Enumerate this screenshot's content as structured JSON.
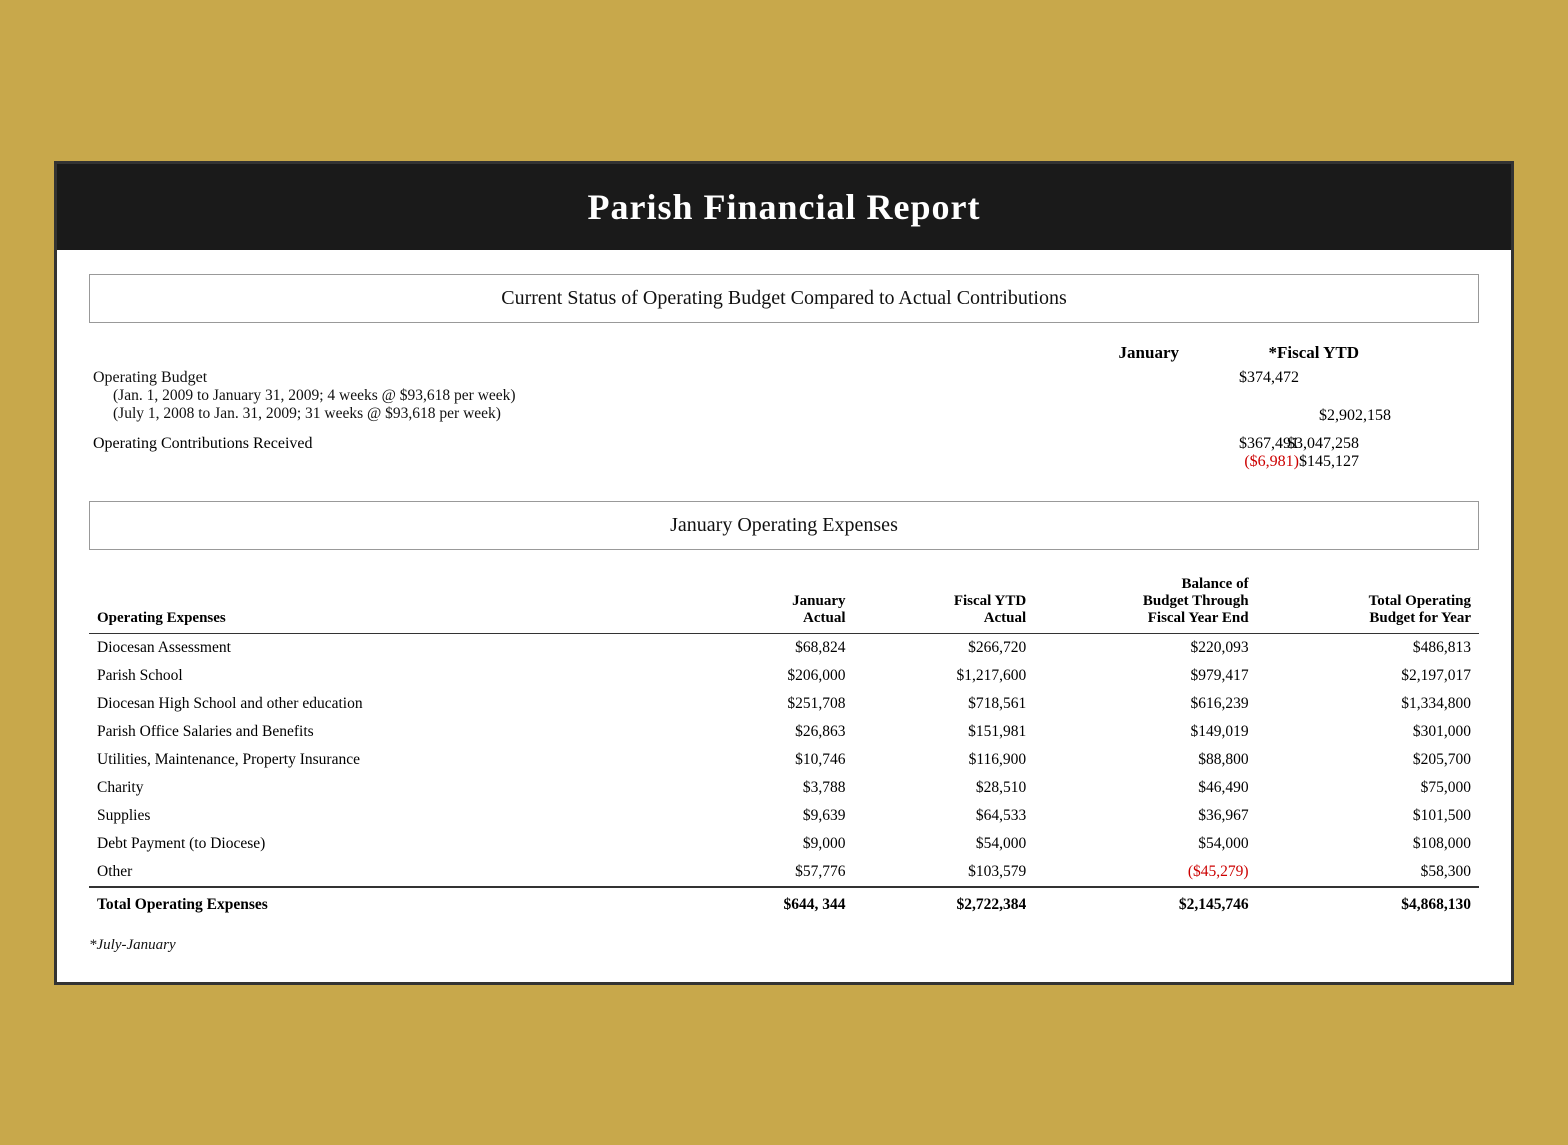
{
  "header": {
    "title": "Parish Financial Report"
  },
  "section1": {
    "title": "Current Status of Operating Budget Compared to Actual Contributions",
    "col_jan": "January",
    "col_ytd": "*Fiscal YTD",
    "operating_budget_label": "Operating Budget",
    "operating_budget_sub1": "(Jan. 1, 2009 to January 31, 2009; 4 weeks @ $93,618 per week)",
    "operating_budget_sub2": "(July 1, 2008 to Jan. 31, 2009; 31 weeks @ $93,618 per week)",
    "operating_budget_jan": "$374,472",
    "operating_budget_ytd": "$2,902,158",
    "contrib_label": "Operating Contributions Received",
    "contrib_jan": "$367,491",
    "contrib_jan_diff": "($6,981)",
    "contrib_ytd": "$3,047,258",
    "contrib_ytd_diff": "$145,127"
  },
  "section2": {
    "title": "January Operating Expenses",
    "col_label": "Operating Expenses",
    "col_jan_actual": "January\nActual",
    "col_fiscal_ytd": "Fiscal YTD\nActual",
    "col_balance": "Balance of\nBudget Through\nFiscal Year End",
    "col_total_budget": "Total Operating\nBudget for Year",
    "rows": [
      {
        "label": "Diocesan Assessment",
        "jan_actual": "$68,824",
        "fiscal_ytd": "$266,720",
        "balance": "$220,093",
        "total_budget": "$486,813",
        "balance_red": false
      },
      {
        "label": "Parish School",
        "jan_actual": "$206,000",
        "fiscal_ytd": "$1,217,600",
        "balance": "$979,417",
        "total_budget": "$2,197,017",
        "balance_red": false
      },
      {
        "label": "Diocesan High School and other education",
        "jan_actual": "$251,708",
        "fiscal_ytd": "$718,561",
        "balance": "$616,239",
        "total_budget": "$1,334,800",
        "balance_red": false
      },
      {
        "label": "Parish Office Salaries and Benefits",
        "jan_actual": "$26,863",
        "fiscal_ytd": "$151,981",
        "balance": "$149,019",
        "total_budget": "$301,000",
        "balance_red": false
      },
      {
        "label": "Utilities, Maintenance, Property Insurance",
        "jan_actual": "$10,746",
        "fiscal_ytd": "$116,900",
        "balance": "$88,800",
        "total_budget": "$205,700",
        "balance_red": false
      },
      {
        "label": "Charity",
        "jan_actual": "$3,788",
        "fiscal_ytd": "$28,510",
        "balance": "$46,490",
        "total_budget": "$75,000",
        "balance_red": false
      },
      {
        "label": "Supplies",
        "jan_actual": "$9,639",
        "fiscal_ytd": "$64,533",
        "balance": "$36,967",
        "total_budget": "$101,500",
        "balance_red": false
      },
      {
        "label": "Debt Payment (to Diocese)",
        "jan_actual": "$9,000",
        "fiscal_ytd": "$54,000",
        "balance": "$54,000",
        "total_budget": "$108,000",
        "balance_red": false
      },
      {
        "label": "Other",
        "jan_actual": "$57,776",
        "fiscal_ytd": "$103,579",
        "balance": "($45,279)",
        "total_budget": "$58,300",
        "balance_red": true
      }
    ],
    "total_label": "Total Operating Expenses",
    "total_jan": "$644, 344",
    "total_ytd": "$2,722,384",
    "total_balance": "$2,145,746",
    "total_budget": "$4,868,130"
  },
  "footnote": "*July-January"
}
